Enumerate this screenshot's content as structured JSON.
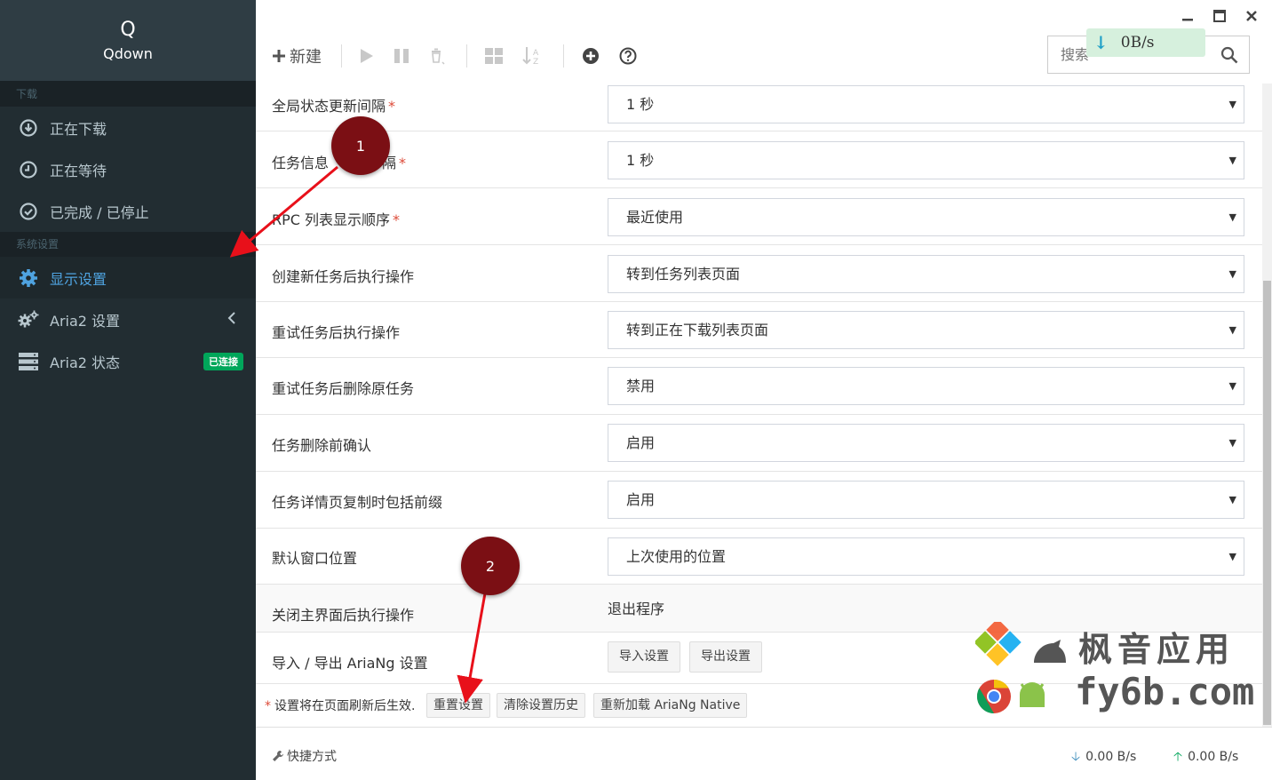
{
  "brand": {
    "glyph": "Q",
    "name": "Qdown"
  },
  "sidebar": {
    "section_download": "下载",
    "downloading": "正在下载",
    "waiting": "正在等待",
    "stopped": "已完成 / 已停止",
    "section_settings": "系统设置",
    "display_settings": "显示设置",
    "aria2_settings": "Aria2 设置",
    "aria2_status": "Aria2 状态",
    "connected_badge": "已连接"
  },
  "toolbar": {
    "new_label": "新建",
    "search_placeholder": "搜索",
    "speed_overlay": "0B/s"
  },
  "settings": [
    {
      "label": "全局状态更新间隔",
      "required": "*",
      "value": "1 秒"
    },
    {
      "label": "任务信息",
      "label_tail": "隔",
      "required": "*",
      "value": "1 秒"
    },
    {
      "label": "RPC 列表显示顺序",
      "required": "*",
      "value": "最近使用"
    },
    {
      "label": "创建新任务后执行操作",
      "value": "转到任务列表页面"
    },
    {
      "label": "重试任务后执行操作",
      "value": "转到正在下载列表页面"
    },
    {
      "label": "重试任务后删除原任务",
      "value": "禁用"
    },
    {
      "label": "任务删除前确认",
      "value": "启用"
    },
    {
      "label": "任务详情页复制时包括前缀",
      "value": "启用"
    },
    {
      "label": "默认窗口位置",
      "value": "上次使用的位置"
    },
    {
      "label": "关闭主界面后执行操作",
      "value": "退出程序"
    },
    {
      "label": "导入 / 导出 AriaNg 设置",
      "import_btn": "导入设置",
      "export_btn": "导出设置"
    }
  ],
  "footer_note": {
    "star": "*",
    "text": "设置将在页面刷新后生效.",
    "reset_btn": "重置设置",
    "clear_btn": "清除设置历史",
    "reload_btn": "重新加载 AriaNg Native"
  },
  "footer": {
    "shortcut": "快捷方式",
    "download_speed": "0.00 B/s",
    "upload_speed": "0.00 B/s"
  },
  "annotations": {
    "one": "1",
    "two": "2"
  },
  "watermark": {
    "line1": "枫音应用",
    "line2": "fy6b.com"
  },
  "colors": {
    "sidebar_bg": "#222d32",
    "active": "#4fa3e0",
    "badge": "#00a65a",
    "annotation": "#7b0f14",
    "arrow": "#e8101a"
  }
}
